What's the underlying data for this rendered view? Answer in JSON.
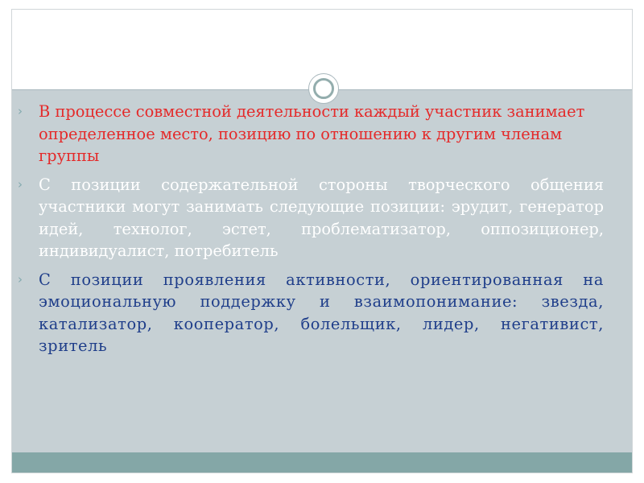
{
  "slide": {
    "bullet_marker": "›",
    "items": [
      {
        "text": "В процессе совместной деятельности каждый участник занимает определенное место, позицию по отношению к другим членам группы",
        "color": "#e42a2a"
      },
      {
        "text": "С позиции содержательной стороны творческого общения участники могут занимать следующие позиции: эрудит, генератор идей, технолог, эстет, проблематизатор, оппозиционер, индивидуалист, потребитель",
        "color": "#ffffff"
      },
      {
        "text": "С позиции проявления активности, ориентированная на эмоциональную поддержку и взаимопонимание: звезда, катализатор, кооператор, болельщик, лидер, негативист, зритель",
        "color": "#1f3e8a"
      }
    ]
  },
  "theme": {
    "content_background": "#c6d0d4",
    "footer_background": "#84a7a7",
    "ornament_ring": "#93adad",
    "ornament_icon": "circle-ornament-icon"
  }
}
